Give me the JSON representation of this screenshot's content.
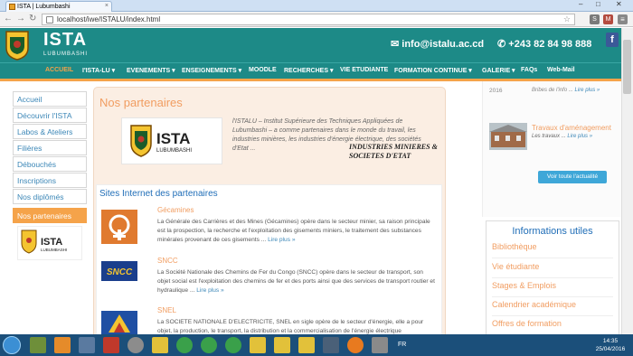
{
  "browser": {
    "tab_title": "ISTA | Lubumbashi",
    "url": "localhost/iwe/ISTALU/index.html"
  },
  "header": {
    "brand": "ISTA",
    "brand_sub": "LUBUMBASHI",
    "email": "info@istalu.ac.cd",
    "phone": "+243 82 84 98 888",
    "facebook_label": "f"
  },
  "menu": [
    {
      "label": "ACCUEIL"
    },
    {
      "label": "I'ISTA-LU ▾"
    },
    {
      "label": "EVENEMENTS ▾"
    },
    {
      "label": "ENSEIGNEMENTS ▾"
    },
    {
      "label": "MOODLE"
    },
    {
      "label": "RECHERCHES ▾"
    },
    {
      "label": "VIE ETUDIANTE"
    },
    {
      "label": "FORMATION CONTINUE ▾"
    },
    {
      "label": "GALERIE ▾"
    },
    {
      "label": "FAQs"
    },
    {
      "label": "Web-Mail"
    }
  ],
  "sidebar": [
    {
      "label": "Accueil"
    },
    {
      "label": "Découvrir l'ISTA"
    },
    {
      "label": "Labos & Ateliers"
    },
    {
      "label": "Filières"
    },
    {
      "label": "Débouchés"
    },
    {
      "label": "Inscriptions"
    },
    {
      "label": "Nos diplômés"
    },
    {
      "label": "Nos partenaires"
    }
  ],
  "main": {
    "title": "Nos partenaires",
    "logo_text": "ISTA",
    "logo_sub": "LUBUMBASHI",
    "intro": "l'ISTALU – Institut Supérieure des Techniques Appliquées de Lubumbashi – a comme partenaires dans le monde du travail, les industries minières, les industries d'énergie électrique, des sociétés d'Etat ...",
    "industries": "INDUSTRIES MINIERES & SOCIETES D'ETAT",
    "sites_title": "Sites Internet des partenaires",
    "partners": [
      {
        "name": "Gécamines",
        "desc": "La Générale des Carrières et des Mines (Gécamines) opère dans le secteur minier, sa raison principale est la prospection, la recherche et l'exploitation des gisements miniers, le traitement des substances minérales provenant de ces gisements ...",
        "more": "Lire plus »"
      },
      {
        "name": "SNCC",
        "desc": "La Société Nationale des Chemins de Fer du Congo (SNCC) opère dans le secteur de transport, son objet social est l'exploitation des chemins de fer et des ports ainsi que des services de transport routier et hydraulique ...",
        "more": "Lire plus »"
      },
      {
        "name": "SNEL",
        "desc": "La SOCIETE NATIONALE D'ELECTRICITE, SNEL en sigle opère de le secteur d'énergie, elle a pour objet, la production, le transport, la distribution et la commercialisation de l'énergie électrique",
        "more": ""
      }
    ]
  },
  "right": {
    "year": "2016",
    "info_text": "Bribes de l'info ...",
    "info_more": "Lire plus »",
    "news_title": "Travaux d'aménagement",
    "news_sub": "Les travaux ...",
    "news_more": "Lire plus »",
    "button": "Voir toute l'actualité",
    "useful_title": "Informations utiles",
    "useful_items": [
      "Bibliothèque",
      "Vie étudiante",
      "Stages & Emplois",
      "Calendrier académique",
      "Offres de formation"
    ]
  },
  "taskbar": {
    "lang": "FR",
    "time": "14:35",
    "date": "25/04/2016"
  }
}
